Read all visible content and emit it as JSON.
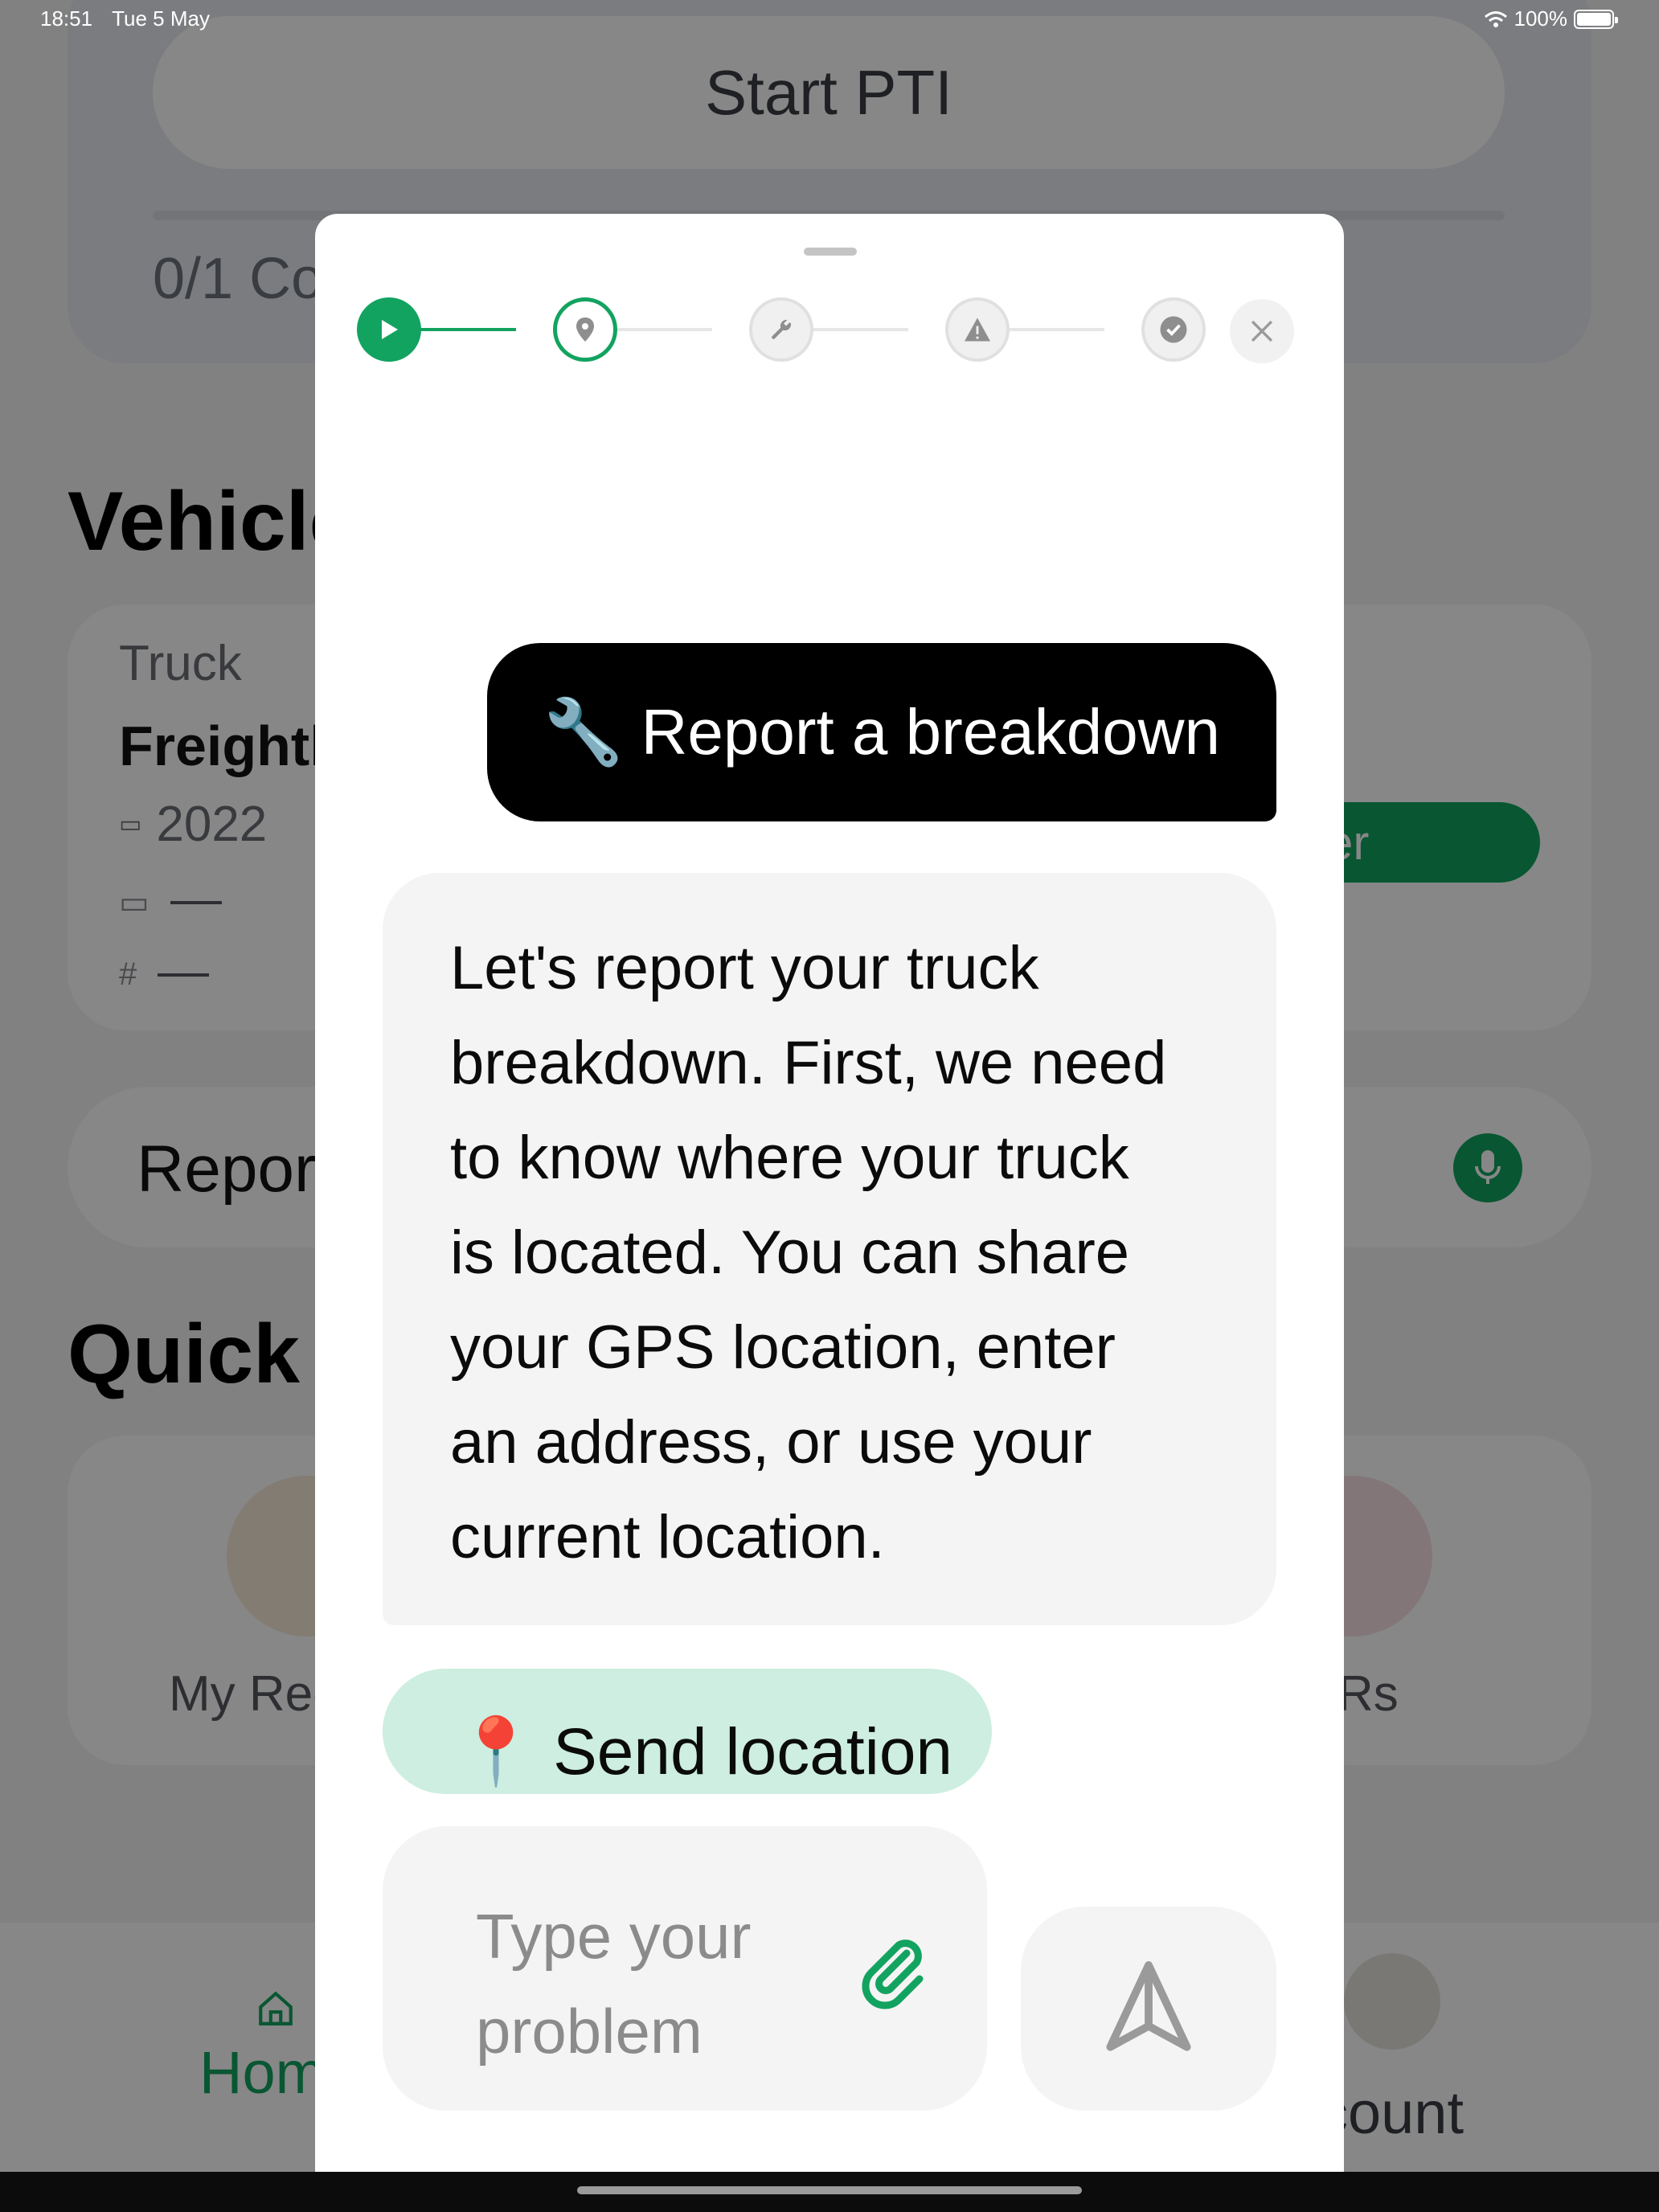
{
  "status_bar": {
    "time": "18:51",
    "date": "Tue 5 May",
    "battery": "100%"
  },
  "background": {
    "pti_button": "Start PTI",
    "pti_progress": "0/1 Co",
    "vehicle_title": "Vehicle",
    "vehicle_type": "Truck",
    "vehicle_name": "Freightl",
    "vehicle_year": "2022",
    "vehicle_button_fragment": "er",
    "report_placeholder": "Report",
    "quick_title": "Quick",
    "quick_left_label": "My Rec",
    "quick_right_label": "Rs",
    "tab_home": "Hom",
    "tab_account": "count"
  },
  "stepper": {
    "steps": [
      "start",
      "location",
      "repair",
      "warning",
      "complete"
    ],
    "active_index": 1
  },
  "chat": {
    "user_message_icon": "🔧",
    "user_message": "Report a breakdown",
    "bot_message_lines": [
      "Let's report your truck",
      "breakdown. First, we need",
      "to know where your truck",
      "is located. You can share",
      "your GPS location, enter",
      "an address, or use your",
      "current location."
    ],
    "location_button_icon": "📍",
    "location_button": "Send location",
    "input_placeholder_lines": [
      "Type your",
      "problem"
    ]
  },
  "colors": {
    "accent": "#12a360",
    "location_bg": "#cdeee0",
    "bubble_bg": "#f4f4f4"
  }
}
